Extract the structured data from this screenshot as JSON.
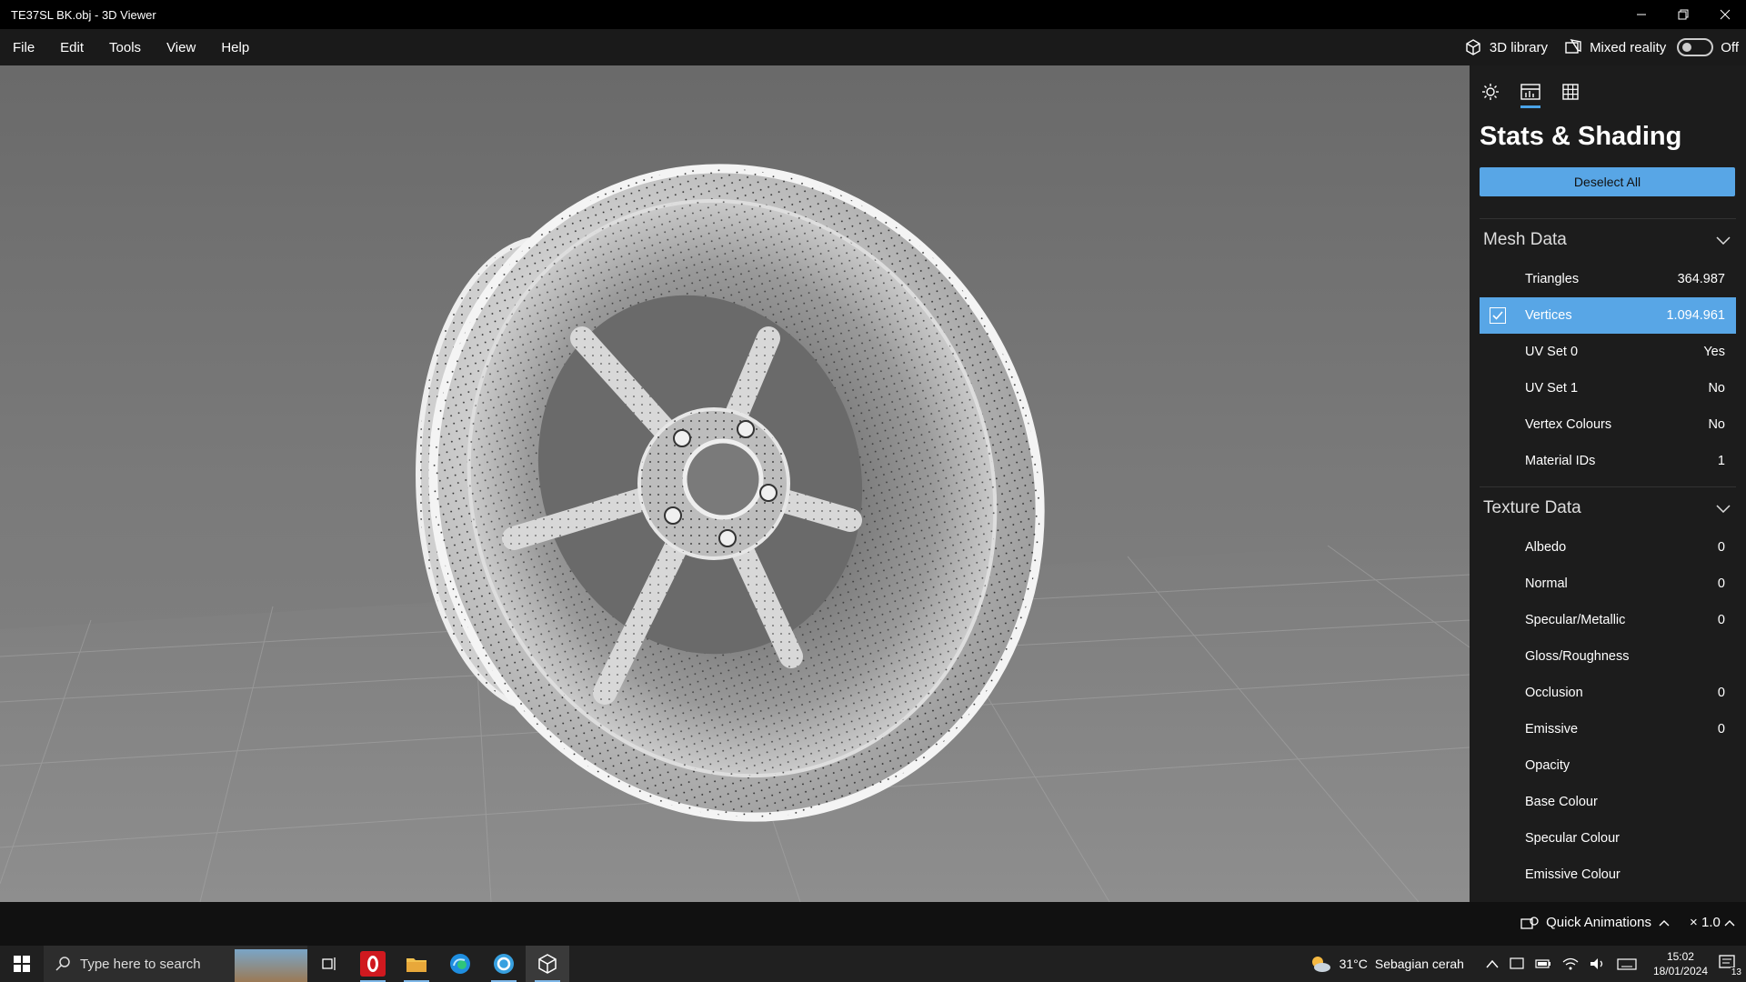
{
  "window": {
    "title": "TE37SL BK.obj - 3D Viewer",
    "minimize": "minimize-icon",
    "restore": "restore-icon",
    "close": "close-icon"
  },
  "menu": {
    "items": [
      "File",
      "Edit",
      "Tools",
      "View",
      "Help"
    ],
    "library_label": "3D library",
    "mixed_reality_label": "Mixed reality",
    "mixed_reality_state": "Off"
  },
  "panel": {
    "tabs": [
      "lighting-tab",
      "stats-tab",
      "grid-tab"
    ],
    "active_tab": 1,
    "title": "Stats & Shading",
    "deselect_label": "Deselect All",
    "accent_color": "#58a6e6",
    "mesh": {
      "heading": "Mesh Data",
      "rows": [
        {
          "label": "Triangles",
          "value": "364.987"
        },
        {
          "label": "Vertices",
          "value": "1.094.961",
          "selected": true
        },
        {
          "label": "UV Set 0",
          "value": "Yes"
        },
        {
          "label": "UV Set 1",
          "value": "No"
        },
        {
          "label": "Vertex Colours",
          "value": "No"
        },
        {
          "label": "Material IDs",
          "value": "1"
        }
      ]
    },
    "texture": {
      "heading": "Texture Data",
      "rows": [
        {
          "label": "Albedo",
          "value": "0"
        },
        {
          "label": "Normal",
          "value": "0"
        },
        {
          "label": "Specular/Metallic",
          "value": "0"
        },
        {
          "label": "Gloss/Roughness",
          "value": ""
        },
        {
          "label": "Occlusion",
          "value": "0"
        },
        {
          "label": "Emissive",
          "value": "0"
        },
        {
          "label": "Opacity",
          "value": ""
        },
        {
          "label": "Base Colour",
          "value": ""
        },
        {
          "label": "Specular Colour",
          "value": ""
        },
        {
          "label": "Emissive Colour",
          "value": ""
        }
      ]
    }
  },
  "status": {
    "quick_animations": "Quick Animations",
    "zoom": "× 1.0"
  },
  "taskbar": {
    "search_placeholder": "Type here to search",
    "weather_temp": "31°C",
    "weather_text": "Sebagian cerah",
    "time": "15:02",
    "date": "18/01/2024",
    "notifications": "13"
  }
}
